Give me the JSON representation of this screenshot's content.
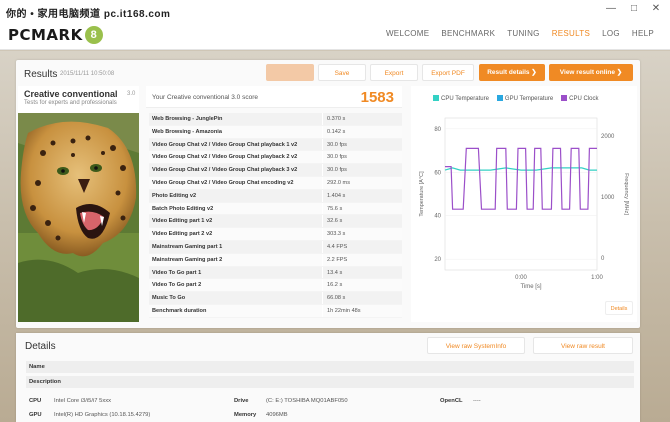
{
  "watermark": "你的 • 家用电脑频道 pc.it168.com",
  "window_controls": {
    "minimize": "—",
    "maximize": "□",
    "close": "✕"
  },
  "app": {
    "logo_text": "PCMARK",
    "logo_badge": "8"
  },
  "nav": [
    {
      "label": "WELCOME"
    },
    {
      "label": "BENCHMARK"
    },
    {
      "label": "TUNING"
    },
    {
      "label": "RESULTS"
    },
    {
      "label": "LOG"
    },
    {
      "label": "HELP"
    }
  ],
  "results": {
    "title": "Results",
    "date": "2015/11/11 10:50:08",
    "buttons": {
      "disabled": "",
      "save": "Save",
      "export": "Export",
      "export_pdf": "Export PDF",
      "result_details": "Result details ❯",
      "view_online": "View result online ❯"
    }
  },
  "test": {
    "name": "Creative conventional",
    "version": "3.0",
    "subtitle": "Tests for experts and professionals"
  },
  "score": {
    "label": "Your Creative conventional 3.0 score",
    "value": "1583"
  },
  "table": [
    {
      "name": "Web Browsing - JunglePin",
      "value": "0.370 s"
    },
    {
      "name": "Web Browsing - Amazonia",
      "value": "0.142 s"
    },
    {
      "name": "Video Group Chat v2 / Video Group Chat playback 1 v2",
      "value": "30.0 fps"
    },
    {
      "name": "Video Group Chat v2 / Video Group Chat playback 2 v2",
      "value": "30.0 fps"
    },
    {
      "name": "Video Group Chat v2 / Video Group Chat playback 3 v2",
      "value": "30.0 fps"
    },
    {
      "name": "Video Group Chat v2 / Video Group Chat encoding v2",
      "value": "292.0 ms"
    },
    {
      "name": "Photo Editing v2",
      "value": "1.404 s"
    },
    {
      "name": "Batch Photo Editing v2",
      "value": "75.6 s"
    },
    {
      "name": "Video Editing part 1 v2",
      "value": "32.6 s"
    },
    {
      "name": "Video Editing part 2 v2",
      "value": "303.3 s"
    },
    {
      "name": "Mainstream Gaming part 1",
      "value": "4.4 FPS"
    },
    {
      "name": "Mainstream Gaming part 2",
      "value": "2.2 FPS"
    },
    {
      "name": "Video To Go part 1",
      "value": "13.4 s"
    },
    {
      "name": "Video To Go part 2",
      "value": "16.2 s"
    },
    {
      "name": "Music To Go",
      "value": "66.08 s"
    },
    {
      "name": "Benchmark duration",
      "value": "1h 22min 48s"
    }
  ],
  "colors": {
    "accent": "#f08a24",
    "cpu_temp": "#33d1c4",
    "gpu_temp": "#2aa8e0",
    "cpu_clock": "#9b4fc9"
  },
  "chart_data": {
    "type": "line",
    "legend": [
      "CPU Temperature",
      "GPU Temperature",
      "CPU Clock"
    ],
    "xlabel": "Time [s]",
    "ylabel_left": "Temperature [A°C]",
    "ylabel_right": "Frequency [MHz]",
    "x_ticks": [
      "0:00",
      "1:00"
    ],
    "y_left_ticks": [
      "20",
      "40",
      "60",
      "80"
    ],
    "y_right_ticks": [
      "0",
      "1000",
      "2000"
    ],
    "ylim_left": [
      15,
      85
    ],
    "ylim_right": [
      -200,
      2300
    ],
    "xlim": [
      0,
      100
    ],
    "series": [
      {
        "name": "CPU Temperature",
        "axis": "left",
        "x": [
          0,
          5,
          10,
          20,
          30,
          40,
          50,
          60,
          70,
          80,
          90,
          95,
          100
        ],
        "y": [
          61,
          62,
          61,
          61,
          61,
          62,
          61,
          61,
          62,
          62,
          62,
          61,
          61
        ]
      },
      {
        "name": "CPU Clock",
        "axis": "right",
        "x": [
          0,
          4,
          5,
          12,
          14,
          22,
          24,
          33,
          34,
          40,
          41,
          47,
          48,
          53,
          54,
          58,
          59,
          63,
          64,
          70,
          71,
          76,
          77,
          82,
          83,
          88,
          89,
          94,
          95,
          100
        ],
        "y": [
          1500,
          1500,
          800,
          800,
          1800,
          1800,
          800,
          800,
          1800,
          1800,
          800,
          800,
          1800,
          1800,
          800,
          800,
          1800,
          1800,
          800,
          800,
          1800,
          1800,
          800,
          800,
          1800,
          1800,
          800,
          800,
          1800,
          1800
        ]
      }
    ]
  },
  "chart_details_btn": "Details",
  "details": {
    "title": "Details",
    "view_sysinfo": "View raw SystemInfo",
    "view_result": "View raw result",
    "name_label": "Name",
    "description_label": "Description",
    "cpu_label": "CPU",
    "cpu_value": "Intel Core i3/i5/i7 5xxx",
    "gpu_label": "GPU",
    "gpu_value": "Intel(R) HD Graphics (10.18.15.4279)",
    "drive_label": "Drive",
    "drive_value": "(C: E:) TOSHIBA MQ01ABF050",
    "memory_label": "Memory",
    "memory_value": "4096MB",
    "opencl_label": "OpenCL",
    "opencl_value": "----"
  }
}
